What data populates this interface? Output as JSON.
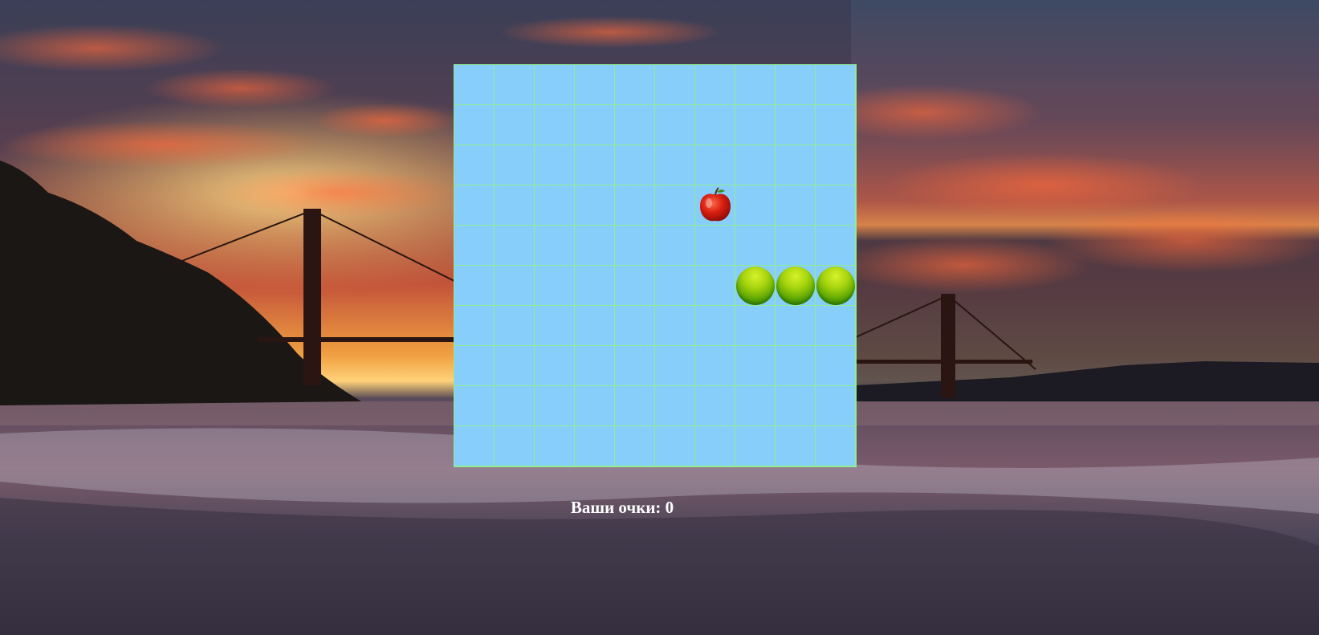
{
  "game": {
    "grid": {
      "cols": 10,
      "rows": 10
    },
    "snake": [
      {
        "col": 7,
        "row": 5
      },
      {
        "col": 8,
        "row": 5
      },
      {
        "col": 9,
        "row": 5
      }
    ],
    "apple": {
      "col": 6,
      "row": 3
    },
    "score_label": "Ваши очки: 0"
  },
  "colors": {
    "board_bg": "#87CEFA",
    "grid_line": "#90EE90",
    "snake": "#8BC800",
    "apple": "#D81E10",
    "score_text": "#FFFFFF"
  },
  "background": {
    "scene": "sunset-bridge-beach"
  }
}
